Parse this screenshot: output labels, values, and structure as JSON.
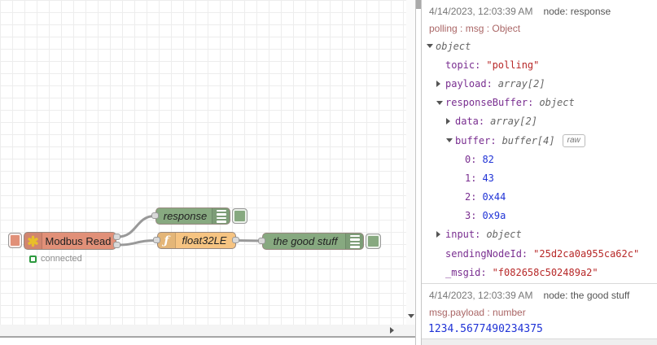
{
  "flow": {
    "nodes": {
      "modbus": {
        "label": "Modbus Read",
        "status": "connected"
      },
      "response": {
        "label": "response"
      },
      "func": {
        "label": "float32LE"
      },
      "goodstuff": {
        "label": "the good stuff"
      }
    },
    "icons": {
      "function_glyph": "ƒ"
    }
  },
  "debug": {
    "messages": [
      {
        "timestamp": "4/14/2023, 12:03:39 AM",
        "node": "node: response",
        "topic_line": "polling : msg : Object",
        "raw_button": "raw",
        "rows": [
          {
            "key": "",
            "value": "object"
          },
          {
            "key": "topic:",
            "value": "\"polling\""
          },
          {
            "key": "payload:",
            "value": "array[2]"
          },
          {
            "key": "responseBuffer:",
            "value": "object"
          },
          {
            "key": "data:",
            "value": "array[2]"
          },
          {
            "key": "buffer:",
            "value": "buffer[4]"
          },
          {
            "key": "0:",
            "value": "82"
          },
          {
            "key": "1:",
            "value": "43"
          },
          {
            "key": "2:",
            "value": "0x44"
          },
          {
            "key": "3:",
            "value": "0x9a"
          },
          {
            "key": "input:",
            "value": "object"
          },
          {
            "key": "sendingNodeId:",
            "value": "\"25d2ca0a955ca62c\""
          },
          {
            "key": "_msgid:",
            "value": "\"f082658c502489a2\""
          }
        ]
      },
      {
        "timestamp": "4/14/2023, 12:03:39 AM",
        "node": "node: the good stuff",
        "topic_line": "msg.payload : number",
        "payload": "1234.5677490234375"
      }
    ]
  },
  "colors": {
    "modbus_node": "#e19078",
    "debug_node": "#87a980",
    "function_node": "#f6c482",
    "wire": "#999999",
    "status_connected": "#2d9a3f",
    "json_key": "#792e90",
    "json_string": "#b72828",
    "json_number": "#2033d6",
    "json_meta": "#666666",
    "topic_text": "#aa6666"
  }
}
